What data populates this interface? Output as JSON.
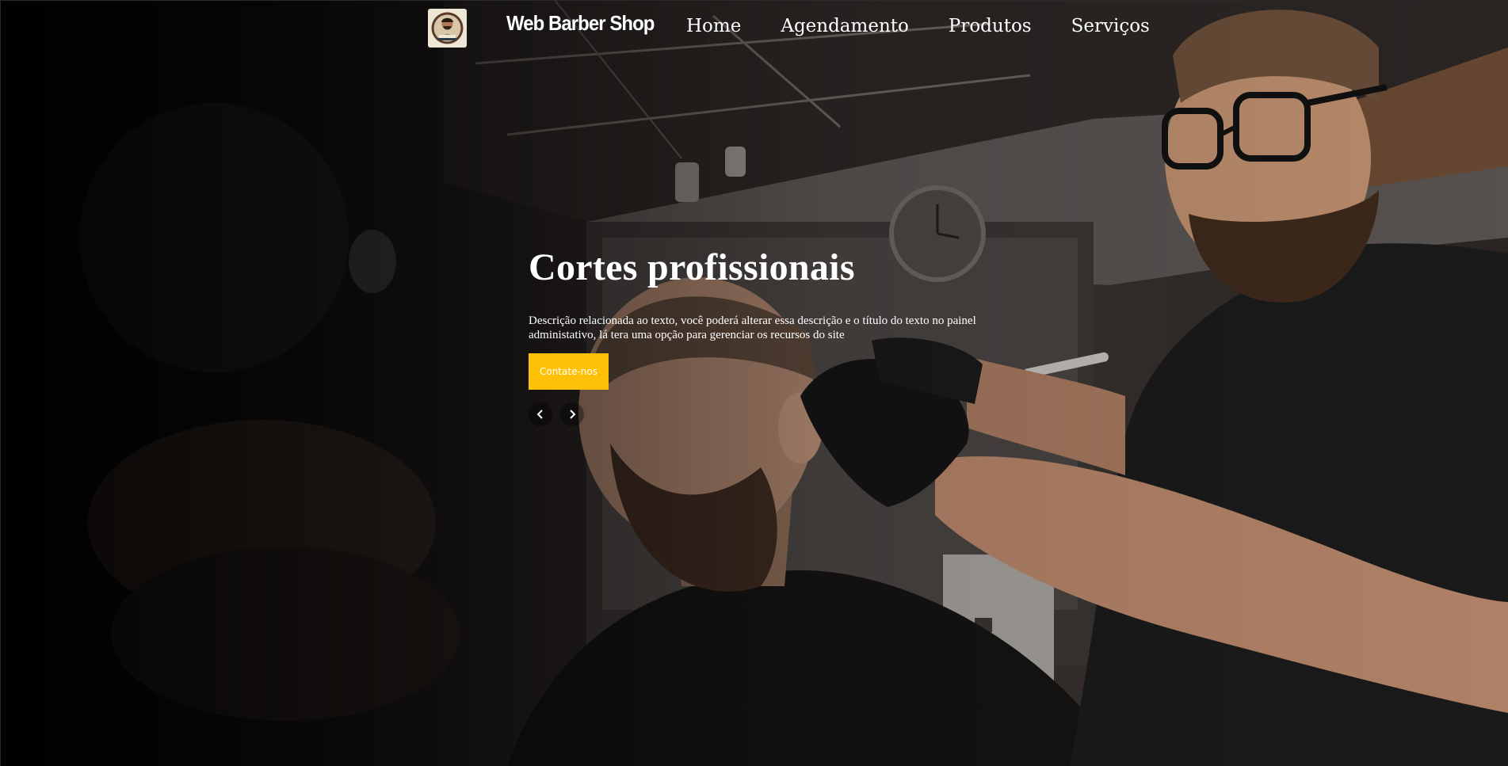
{
  "header": {
    "logo_icon": "barber-logo-icon",
    "brand": "Web Barber Shop",
    "nav": [
      {
        "label": "Home"
      },
      {
        "label": "Agendamento"
      },
      {
        "label": "Produtos"
      },
      {
        "label": "Serviços"
      }
    ]
  },
  "hero": {
    "background": "barbershop-photo",
    "title": "Cortes profissionais",
    "description": "Descrição relacionada ao texto, você poderá alterar essa descrição e o título do texto no painel administativo, lá tera uma opção para gerenciar os recursos do site",
    "cta_label": "Contate-nos",
    "prev_icon": "chevron-left-icon",
    "next_icon": "chevron-right-icon"
  },
  "colors": {
    "accent": "#ffc107",
    "text": "#ffffff",
    "background": "#0b0a0a"
  }
}
